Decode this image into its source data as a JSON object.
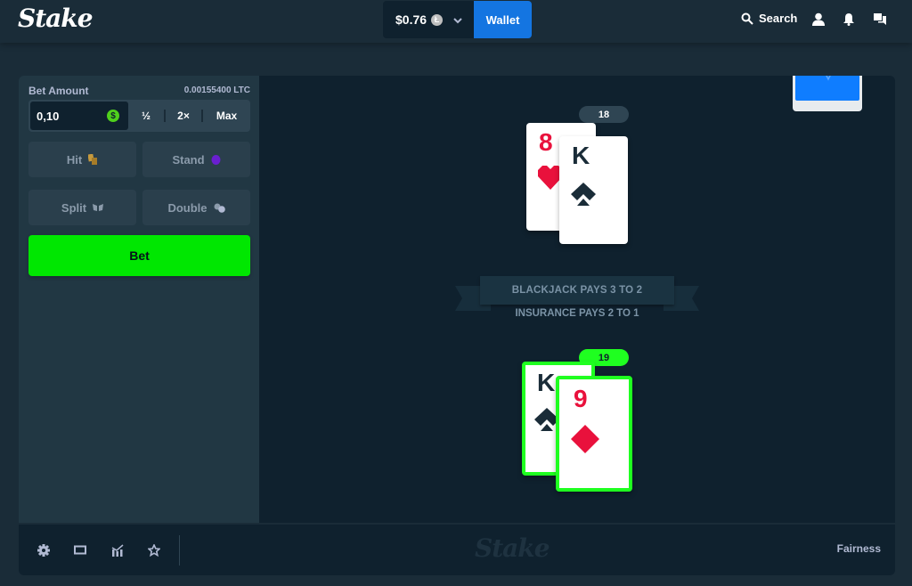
{
  "header": {
    "logo": "Stake",
    "balance": "$0.76",
    "currency_icon": "litecoin-icon",
    "wallet_label": "Wallet",
    "search_label": "Search",
    "icons": [
      "search-icon",
      "user-icon",
      "bell-icon",
      "chat-icon"
    ]
  },
  "sidebar": {
    "bet_amount_label": "Bet Amount",
    "bet_amount_crypto": "0.00155400 LTC",
    "bet_amount_value": "0,10",
    "half_label": "½",
    "double_label": "2×",
    "max_label": "Max",
    "actions": [
      {
        "label": "Hit",
        "icon": "hit-cards-icon",
        "color": "#c69a3e"
      },
      {
        "label": "Stand",
        "icon": "stand-hand-icon",
        "color": "#6a1fd0"
      },
      {
        "label": "Split",
        "icon": "split-icon",
        "color": "#8b9bab"
      },
      {
        "label": "Double",
        "icon": "double-chips-icon",
        "color": "#8b9bab"
      }
    ],
    "bet_label": "Bet",
    "bet_color": "#00e701"
  },
  "game": {
    "dealer": {
      "score": "18",
      "cards": [
        {
          "rank": "8",
          "suit": "hearts"
        },
        {
          "rank": "K",
          "suit": "spades"
        }
      ]
    },
    "player": {
      "score": "19",
      "cards": [
        {
          "rank": "K",
          "suit": "spades"
        },
        {
          "rank": "9",
          "suit": "diamonds"
        }
      ]
    },
    "ribbon_text": "BLACKJACK PAYS 3 TO 2",
    "insurance_text": "INSURANCE PAYS 2 TO 1"
  },
  "footer": {
    "icons": [
      "settings-icon",
      "theatre-mode-icon",
      "stats-icon",
      "favourite-icon"
    ],
    "logo": "Stake",
    "fairness_label": "Fairness"
  }
}
